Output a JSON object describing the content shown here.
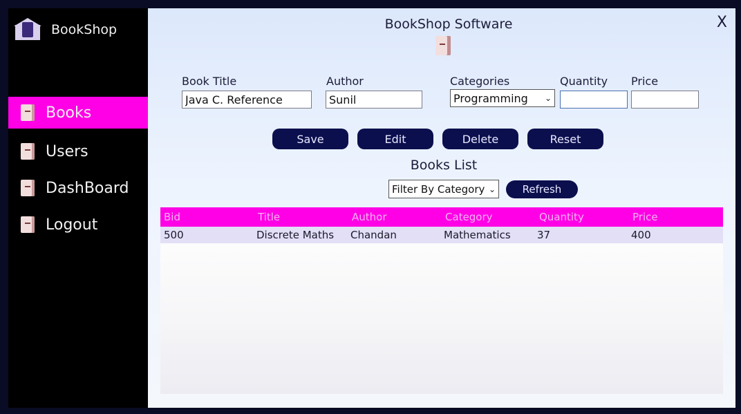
{
  "sidebar": {
    "brand": "BookShop",
    "items": [
      {
        "label": "Books",
        "active": true
      },
      {
        "label": "Users",
        "active": false
      },
      {
        "label": "DashBoard",
        "active": false
      },
      {
        "label": "Logout",
        "active": false
      }
    ]
  },
  "main": {
    "title": "BookShop Software",
    "close_label": "X",
    "form": {
      "book_title_label": "Book Title",
      "book_title_value": "Java C. Reference",
      "author_label": "Author",
      "author_value": "Sunil",
      "categories_label": "Categories",
      "categories_value": "Programming",
      "quantity_label": "Quantity",
      "quantity_value": "",
      "price_label": "Price",
      "price_value": ""
    },
    "buttons": {
      "save": "Save",
      "edit": "Edit",
      "delete": "Delete",
      "reset": "Reset"
    },
    "list_title": "Books List",
    "filter_value": "Filter By Category",
    "refresh_label": "Refresh",
    "table": {
      "headers": [
        "Bid",
        "Title",
        "Author",
        "Category",
        "Quantity",
        "Price"
      ],
      "rows": [
        [
          "500",
          "Discrete Maths",
          "Chandan",
          "Mathematics",
          "37",
          "400"
        ]
      ]
    }
  },
  "colors": {
    "accent": "#ff00e6",
    "button": "#0b0f4d",
    "sidebar": "#000000"
  }
}
